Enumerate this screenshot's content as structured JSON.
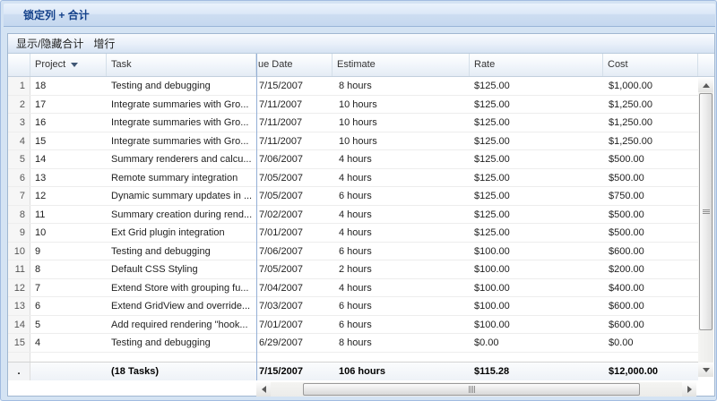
{
  "window": {
    "title": "锁定列 + 合计"
  },
  "toolbar": {
    "buttons": [
      {
        "label": "显示/隐藏合计"
      },
      {
        "label": "增行"
      }
    ]
  },
  "grid": {
    "header": {
      "columns": [
        {
          "key": "project",
          "label": "Project",
          "sort": "desc"
        },
        {
          "key": "task",
          "label": "Task"
        },
        {
          "key": "due",
          "label": "ue Date"
        },
        {
          "key": "estimate",
          "label": "Estimate"
        },
        {
          "key": "rate",
          "label": "Rate"
        },
        {
          "key": "cost",
          "label": "Cost"
        }
      ]
    },
    "rows": [
      {
        "num": "1",
        "project": "18",
        "task": "Testing and debugging",
        "due": "7/15/2007",
        "estimate": "8 hours",
        "rate": "$125.00",
        "cost": "$1,000.00"
      },
      {
        "num": "2",
        "project": "17",
        "task": "Integrate summaries with Gro...",
        "due": "7/11/2007",
        "estimate": "10 hours",
        "rate": "$125.00",
        "cost": "$1,250.00"
      },
      {
        "num": "3",
        "project": "16",
        "task": "Integrate summaries with Gro...",
        "due": "7/11/2007",
        "estimate": "10 hours",
        "rate": "$125.00",
        "cost": "$1,250.00"
      },
      {
        "num": "4",
        "project": "15",
        "task": "Integrate summaries with Gro...",
        "due": "7/11/2007",
        "estimate": "10 hours",
        "rate": "$125.00",
        "cost": "$1,250.00"
      },
      {
        "num": "5",
        "project": "14",
        "task": "Summary renderers and calcu...",
        "due": "7/06/2007",
        "estimate": "4 hours",
        "rate": "$125.00",
        "cost": "$500.00"
      },
      {
        "num": "6",
        "project": "13",
        "task": "Remote summary integration",
        "due": "7/05/2007",
        "estimate": "4 hours",
        "rate": "$125.00",
        "cost": "$500.00"
      },
      {
        "num": "7",
        "project": "12",
        "task": "Dynamic summary updates in ...",
        "due": "7/05/2007",
        "estimate": "6 hours",
        "rate": "$125.00",
        "cost": "$750.00"
      },
      {
        "num": "8",
        "project": "11",
        "task": "Summary creation during rend...",
        "due": "7/02/2007",
        "estimate": "4 hours",
        "rate": "$125.00",
        "cost": "$500.00"
      },
      {
        "num": "9",
        "project": "10",
        "task": "Ext Grid plugin integration",
        "due": "7/01/2007",
        "estimate": "4 hours",
        "rate": "$125.00",
        "cost": "$500.00"
      },
      {
        "num": "10",
        "project": "9",
        "task": "Testing and debugging",
        "due": "7/06/2007",
        "estimate": "6 hours",
        "rate": "$100.00",
        "cost": "$600.00"
      },
      {
        "num": "11",
        "project": "8",
        "task": "Default CSS Styling",
        "due": "7/05/2007",
        "estimate": "2 hours",
        "rate": "$100.00",
        "cost": "$200.00"
      },
      {
        "num": "12",
        "project": "7",
        "task": "Extend Store with grouping fu...",
        "due": "7/04/2007",
        "estimate": "4 hours",
        "rate": "$100.00",
        "cost": "$400.00"
      },
      {
        "num": "13",
        "project": "6",
        "task": "Extend GridView and override...",
        "due": "7/03/2007",
        "estimate": "6 hours",
        "rate": "$100.00",
        "cost": "$600.00"
      },
      {
        "num": "14",
        "project": "5",
        "task": "Add required rendering \"hook...",
        "due": "7/01/2007",
        "estimate": "6 hours",
        "rate": "$100.00",
        "cost": "$600.00"
      },
      {
        "num": "15",
        "project": "4",
        "task": "Testing and debugging",
        "due": "6/29/2007",
        "estimate": "8 hours",
        "rate": "$0.00",
        "cost": "$0.00"
      }
    ],
    "summary": {
      "num": ".",
      "project": "",
      "task": "(18 Tasks)",
      "due": "7/15/2007",
      "estimate": "106 hours",
      "rate": "$115.28",
      "cost": "$12,000.00"
    }
  },
  "colors": {
    "title_text": "#15428b",
    "frame_border": "#a2bce0",
    "locked_divider": "#94afd6",
    "header_border": "#c3cfdd"
  }
}
